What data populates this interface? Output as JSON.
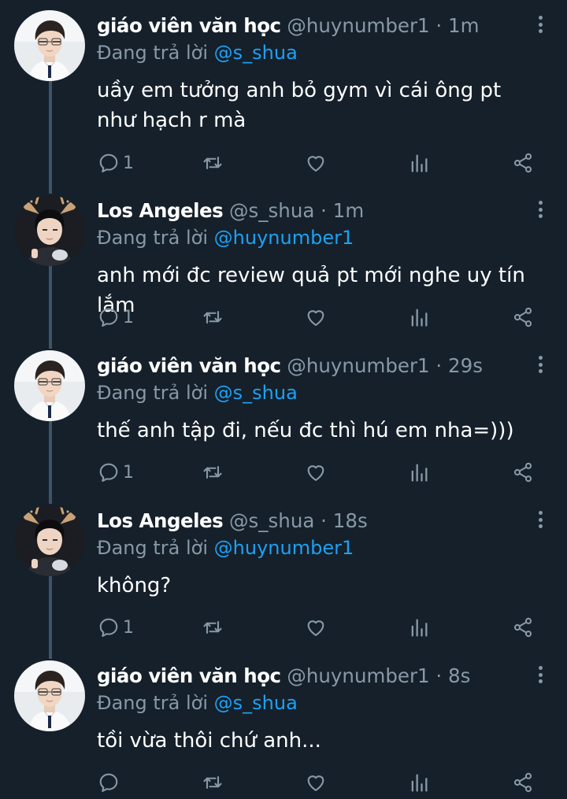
{
  "tweets": [
    {
      "author": "giáo viên văn học",
      "handle": "@huynumber1",
      "time": "1m",
      "reply_prefix": "Đang trả lời",
      "reply_to": "@s_shua",
      "text": "uầy em tưởng anh bỏ gym vì cái ông pt như hạch r mà",
      "reply_count": "1",
      "avatar": "boy-avatar"
    },
    {
      "author": "Los Angeles",
      "handle": "@s_shua",
      "time": "1m",
      "reply_prefix": "Đang trả lời",
      "reply_to": "@huynumber1",
      "text": "anh mới đc review quả pt mới nghe uy tín lắm",
      "reply_count": "1",
      "avatar": "deer-ears-avatar"
    },
    {
      "author": "giáo viên văn học",
      "handle": "@huynumber1",
      "time": "29s",
      "reply_prefix": "Đang trả lời",
      "reply_to": "@s_shua",
      "text": "thế anh tập đi, nếu đc thì hú em nha=)))",
      "reply_count": "1",
      "avatar": "boy-avatar"
    },
    {
      "author": "Los Angeles",
      "handle": "@s_shua",
      "time": "18s",
      "reply_prefix": "Đang trả lời",
      "reply_to": "@huynumber1",
      "text": "không?",
      "reply_count": "1",
      "avatar": "deer-ears-avatar"
    },
    {
      "author": "giáo viên văn học",
      "handle": "@huynumber1",
      "time": "8s",
      "reply_prefix": "Đang trả lời",
      "reply_to": "@s_shua",
      "text": "tồi vừa thôi chứ anh...",
      "reply_count": "",
      "avatar": "boy-avatar"
    }
  ],
  "separator": "·",
  "icons": {
    "reply": "reply-icon",
    "retweet": "retweet-icon",
    "like": "like-icon",
    "analytics": "analytics-icon",
    "share": "share-icon",
    "more": "more-options-icon"
  },
  "colors": {
    "background": "#15202b",
    "text_primary": "#ffffff",
    "text_secondary": "#8899a6",
    "link": "#1da1f2",
    "thread_line": "#3d5466"
  }
}
